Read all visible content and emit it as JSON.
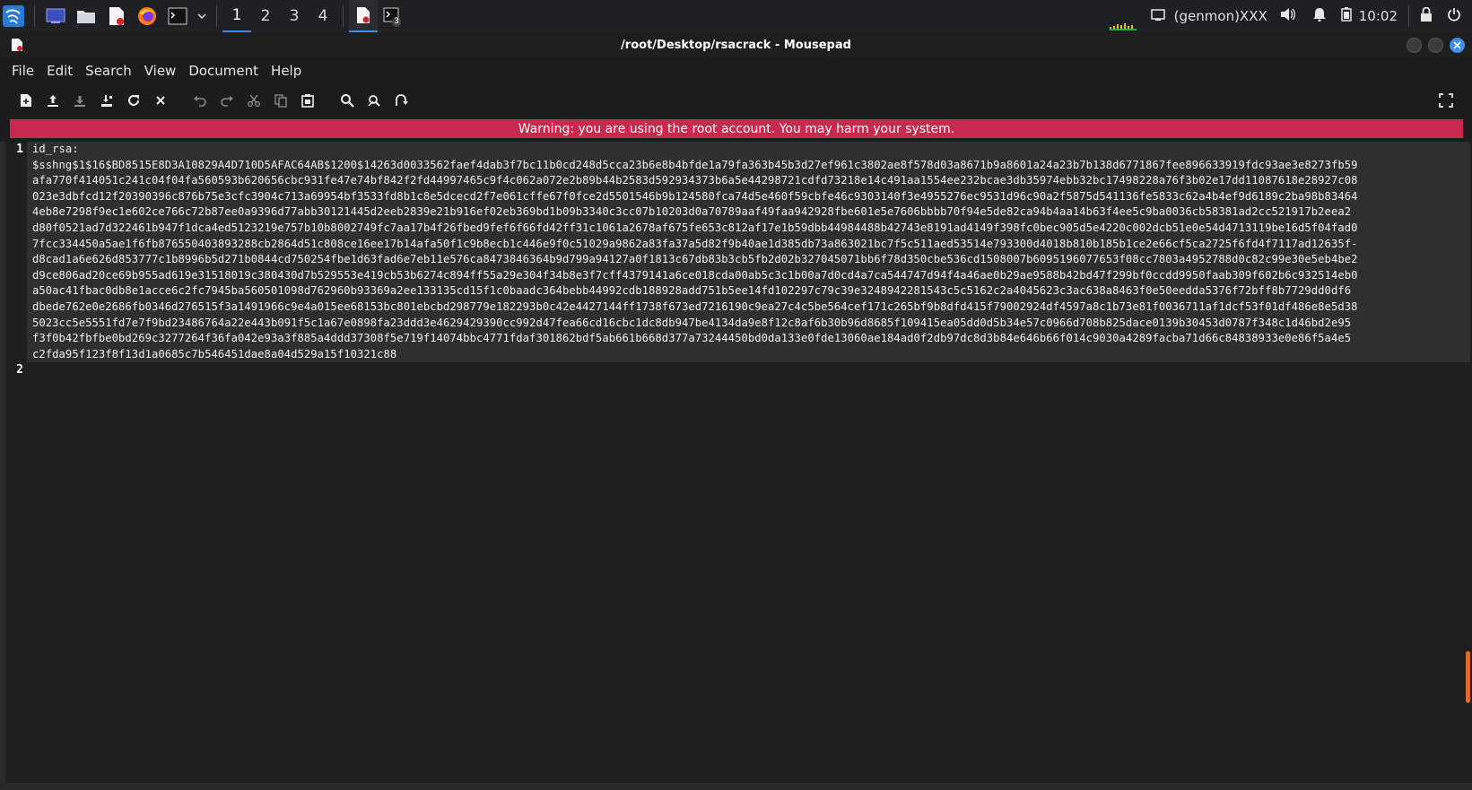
{
  "taskbar": {
    "workspaces": [
      "1",
      "2",
      "3",
      "4"
    ],
    "tray": {
      "genmon": "(genmon)XXX",
      "clock": "10:02"
    },
    "terminal_badge": "3"
  },
  "window": {
    "title": "/root/Desktop/rsacrack - Mousepad"
  },
  "menu": {
    "file": "File",
    "edit": "Edit",
    "search": "Search",
    "view": "View",
    "document": "Document",
    "help": "Help"
  },
  "warning": "Warning: you are using the root account. You may harm your system.",
  "editor": {
    "line_numbers": [
      "1",
      "2"
    ],
    "lines": [
      "id_rsa:",
      "$sshng$1$16$BD8515E8D3A10829A4D710D5AFAC64AB$1200$14263d0033562faef4dab3f7bc11b0cd248d5cca23b6e8b4bfde1a79fa363b45b3d27ef961c3802ae8f578d03a8671b9a8601a24a23b7b138d6771867fee896633919fdc93ae3e8273fb59",
      "afa770f414051c241c04f04fa560593b620656cbc931fe47e74bf842f2fd44997465c9f4c062a072e2b89b44b2583d592934373b6a5e44298721cdfd73218e14c491aa1554ee232bcae3db35974ebb32bc17498228a76f3b02e17dd11087618e28927c08",
      "023e3dbfcd12f20390396c876b75e3cfc3904c713a69954bf3533fd8b1c8e5dcecd2f7e061cffe67f0fce2d5501546b9b124580fca74d5e460f59cbfe46c9303140f3e4955276ec9531d96c90a2f5875d541136fe5833c62a4b4ef9d6189c2ba98b83464",
      "4eb8e7298f9ec1e602ce766c72b87ee0a9396d77abb30121445d2eeb2839e21b916ef02eb369bd1b09b3340c3cc07b10203d0a70789aaf49faa942928fbe601e5e7606bbbb70f94e5de82ca94b4aa14b63f4ee5c9ba0036cb58381ad2cc521917b2eea2",
      "d80f0521ad7d322461b947f1dca4ed5123219e757b10b8002749fc7aa17b4f26fbed9fef6f66fd42ff31c1061a2678af675fe653c812af17e1b59dbb44984488b42743e8191ad4149f398fc0bec905d5e4220c002dcb51e0e54d4713119be16d5f04fad0",
      "7fcc334450a5ae1f6fb876550403893288cb2864d51c808ce16ee17b14afa50f1c9b8ecb1c446e9f0c51029a9862a83fa37a5d82f9b40ae1d385db73a863021bc7f5c511aed53514e793300d4018b810b185b1ce2e66cf5ca2725f6fd4f7117ad12635f-",
      "d8cad1a6e626d853777c1b8996b5d271b0844cd750254fbe1d63fad6e7eb11e576ca8473846364b9d799a94127a0f1813c67db83b3cb5fb2d02b327045071bb6f78d350cbe536cd1508007b6095196077653f08cc7803a4952788d0c82c99e30e5eb4be2",
      "d9ce806ad20ce69b955ad619e31518019c380430d7b529553e419cb53b6274c894ff55a29e304f34b8e3f7cff4379141a6ce018cda00ab5c3c1b00a7d0cd4a7ca544747d94f4a46ae0b29ae9588b42bd47f299bf0ccdd9950faab309f602b6c932514eb0",
      "a50ac41fbac0db8e1acce6c2fc7945ba560501098d762960b93369a2ee133135cd15f1c0baadc364bebb44992cdb188928add751b5ee14fd102297c79c39e3248942281543c5c5162c2a4045623c3ac638a8463f0e50eedda5376f72bff8b7729dd0df6",
      "dbede762e0e2686fb0346d276515f3a1491966c9e4a015ee68153bc801ebcbd298779e182293b0c42e4427144ff1738f673ed7216190c9ea27c4c5be564cef171c265bf9b8dfd415f79002924df4597a8c1b73e81f0036711af1dcf53f01df486e8e5d38",
      "5023cc5e5551fd7e7f9bd23486764a22e443b091f5c1a67e0898fa23ddd3e4629429390cc992d47fea66cd16cbc1dc8db947be4134da9e8f12c8af6b30b96d8685f109415ea05dd0d5b34e57c0966d708b825dace0139b30453d0787f348c1d46bd2e95",
      "f3f0b42fbfbe0bd269c3277264f36fa042e93a3f885a4ddd37308f5e719f14074bbc4771fdaf301862bdf5ab661b668d377a73244450bd0da133e0fde13060ae184ad0f2db97dc8d3b84e646b66f014c9030a4289facba71d66c84838933e0e86f5a4e5",
      "c2fda95f123f8f13d1a0685c7b546451dae8a04d529a15f10321c88"
    ]
  }
}
